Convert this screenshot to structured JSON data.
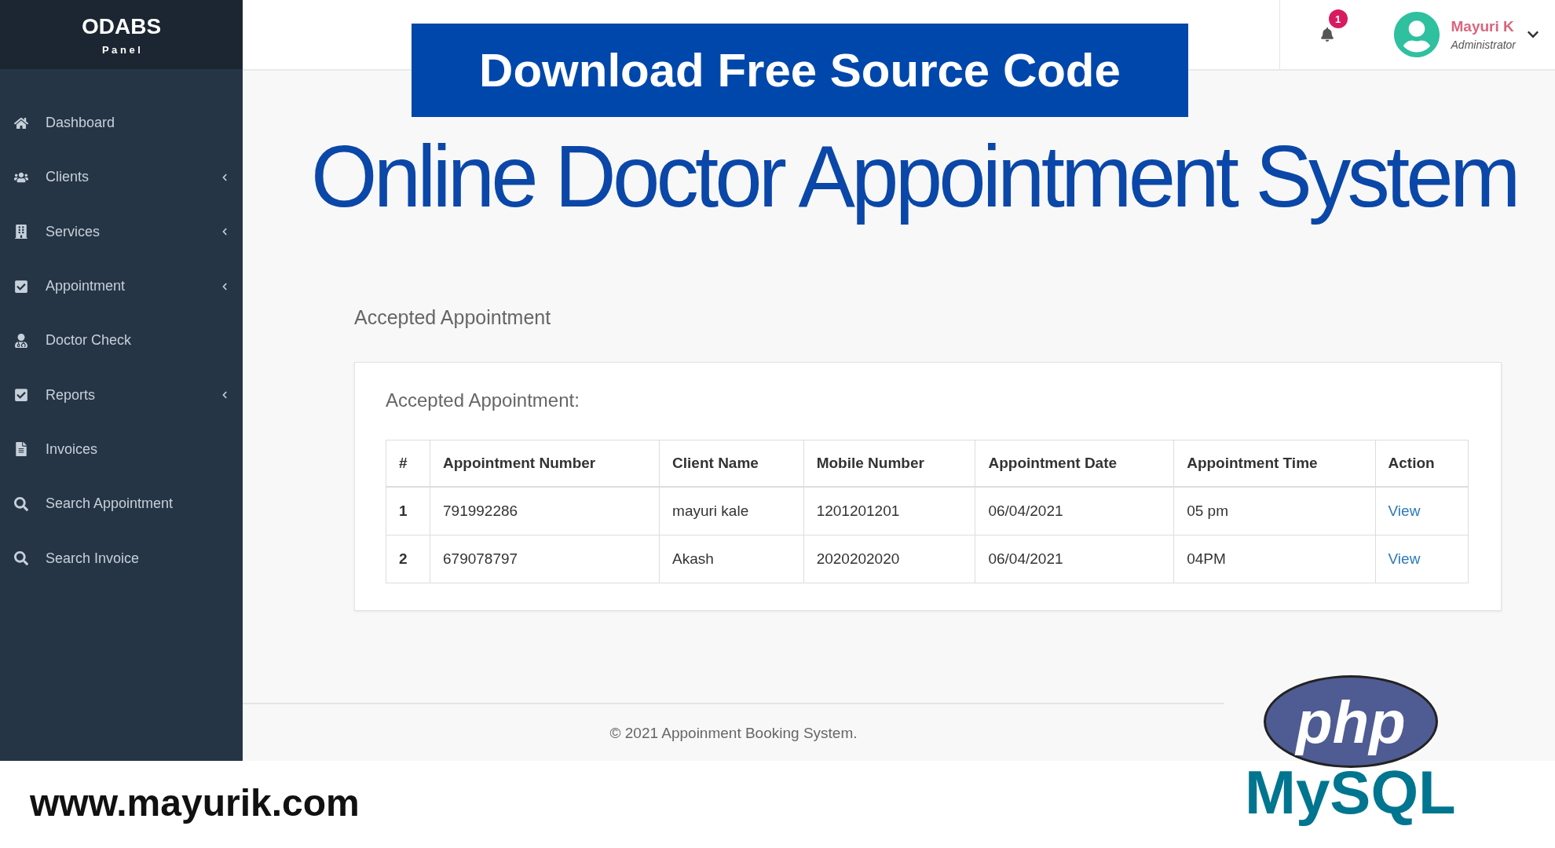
{
  "sidebar": {
    "brand": "ODABS",
    "subtitle": "P a n e l",
    "items": [
      {
        "label": "Dashboard",
        "expandable": false
      },
      {
        "label": "Clients",
        "expandable": true
      },
      {
        "label": "Services",
        "expandable": true
      },
      {
        "label": "Appointment",
        "expandable": true
      },
      {
        "label": "Doctor Check",
        "expandable": false
      },
      {
        "label": "Reports",
        "expandable": true
      },
      {
        "label": "Invoices",
        "expandable": false
      },
      {
        "label": "Search Appointment",
        "expandable": false
      },
      {
        "label": "Search Invoice",
        "expandable": false
      }
    ]
  },
  "header": {
    "notification_count": "1",
    "user_name": "Mayuri K",
    "user_role": "Administrator"
  },
  "page_title": "Accepted Appointment",
  "card": {
    "title": "Accepted Appointment:",
    "columns": [
      "#",
      "Appointment Number",
      "Client Name",
      "Mobile Number",
      "Appointment Date",
      "Appointment Time",
      "Action"
    ],
    "rows": [
      {
        "cells": [
          "1",
          "791992286",
          "mayuri kale",
          "1201201201",
          "06/04/2021",
          "05 pm"
        ],
        "action": "View"
      },
      {
        "cells": [
          "2",
          "679078797",
          "Akash",
          "2020202020",
          "06/04/2021",
          "04PM"
        ],
        "action": "View"
      }
    ]
  },
  "footer": "© 2021 Appoinment Booking System.",
  "promo": {
    "banner": "Download Free Source Code",
    "headline": "Online Doctor Appointment System",
    "website": "www.mayurik.com",
    "logo_php": "php",
    "logo_mysql": "MySQL"
  }
}
